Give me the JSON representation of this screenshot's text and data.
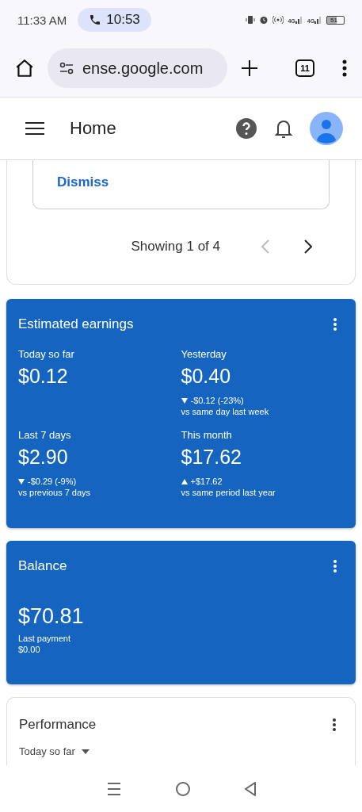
{
  "status_bar": {
    "time": "11:33 AM",
    "call_timer": "10:53",
    "networks": [
      "4G",
      "4G"
    ],
    "battery": "51"
  },
  "browser": {
    "url": "ense.google.com",
    "tab_count": "11"
  },
  "header": {
    "title": "Home"
  },
  "notice": {
    "action": "Dismiss",
    "pager": "Showing 1 of 4",
    "prev_disabled": true,
    "next_disabled": false
  },
  "earnings": {
    "title": "Estimated earnings",
    "metrics": [
      {
        "label": "Today so far",
        "value": "$0.12"
      },
      {
        "label": "Yesterday",
        "value": "$0.40",
        "kind": "down",
        "change": "-$0.12 (-23%)",
        "compare": "vs same day last week"
      },
      {
        "label": "Last 7 days",
        "value": "$2.90",
        "kind": "down",
        "change": "-$0.29 (-9%)",
        "compare": "vs previous 7 days"
      },
      {
        "label": "This month",
        "value": "$17.62",
        "kind": "up",
        "change": "+$17.62",
        "compare": "vs same period last year"
      }
    ]
  },
  "balance": {
    "title": "Balance",
    "value": "$70.81",
    "label": "Last payment",
    "last_payment": "$0.00"
  },
  "performance": {
    "title": "Performance",
    "range": "Today so far"
  }
}
